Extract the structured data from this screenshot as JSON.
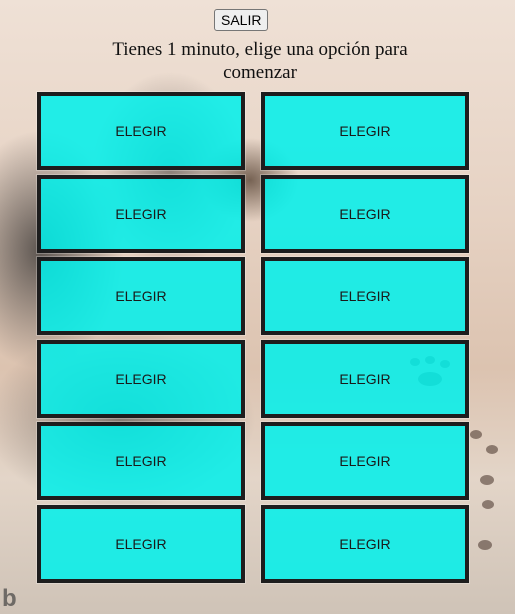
{
  "header": {
    "exit_label": "SALIR",
    "instruction": "Tienes 1 minuto, elige una opción para comenzar"
  },
  "options": [
    {
      "label": "ELEGIR"
    },
    {
      "label": "ELEGIR"
    },
    {
      "label": "ELEGIR"
    },
    {
      "label": "ELEGIR"
    },
    {
      "label": "ELEGIR"
    },
    {
      "label": "ELEGIR"
    },
    {
      "label": "ELEGIR"
    },
    {
      "label": "ELEGIR"
    },
    {
      "label": "ELEGIR"
    },
    {
      "label": "ELEGIR"
    },
    {
      "label": "ELEGIR"
    },
    {
      "label": "ELEGIR"
    }
  ],
  "background": {
    "description_icon": "kitten-photo-background",
    "watermark_icon": "bing-logo-icon"
  },
  "colors": {
    "option_fill": "#00f0eb",
    "option_border": "#1d1d1d"
  }
}
